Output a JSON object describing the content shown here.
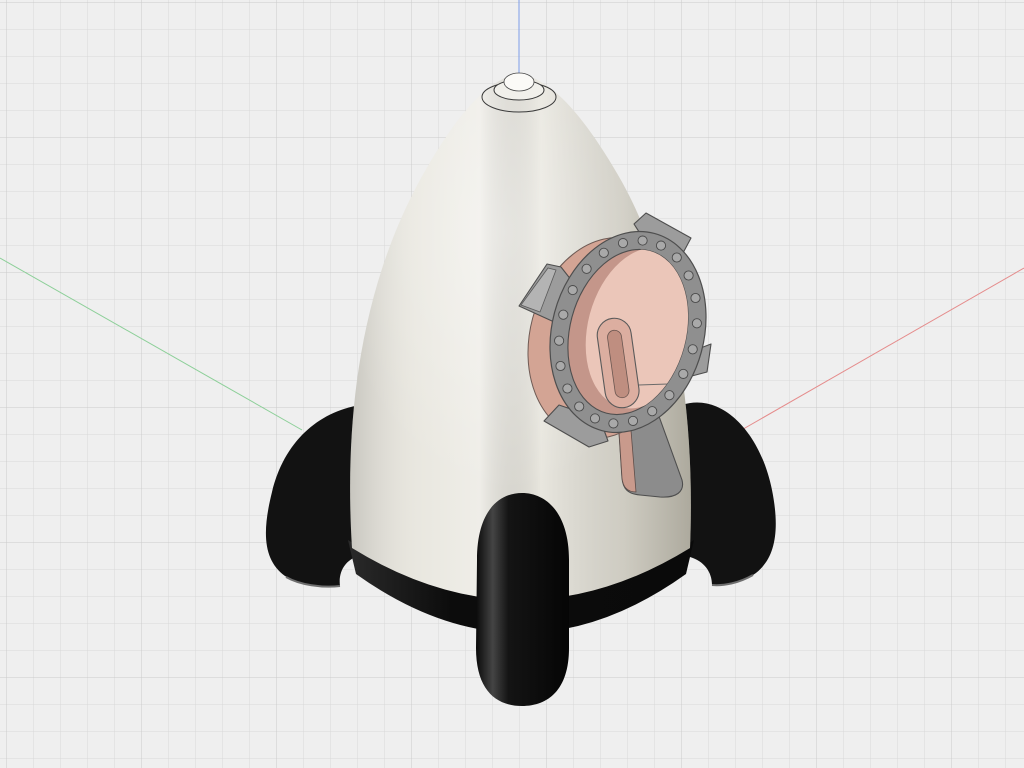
{
  "viewport": {
    "background": "#efefef",
    "grid_line": "#d8d8d8",
    "grid_major": "#cbcbcb"
  },
  "axes": {
    "x": "#e58b8b",
    "y": "#8ccf98",
    "z": "#7e9ee8"
  },
  "model": {
    "body": "#e8e6de",
    "fins": "#121212",
    "porthole_ring": "#8f8f8f",
    "porthole_glass": "#ebc6b9",
    "porthole_sleeve": "#d3a494"
  }
}
